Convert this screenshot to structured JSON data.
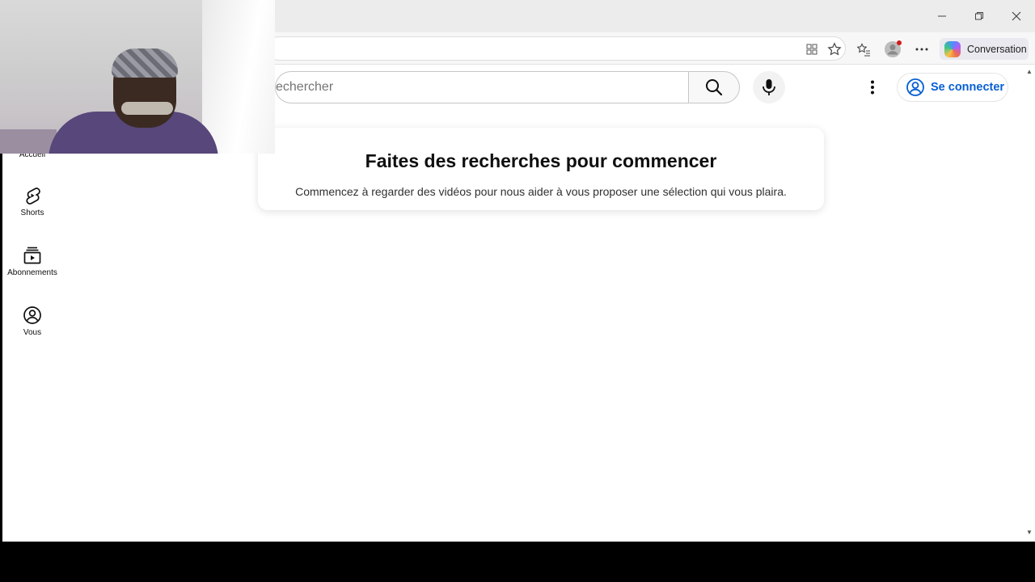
{
  "browser": {
    "copilot_label": "Conversation",
    "window_controls": [
      "minimize-icon",
      "restore-icon",
      "close-icon"
    ],
    "toolbar_icons": [
      "extensions-icon",
      "favorite-star-icon",
      "favorites-list-icon",
      "profile-icon",
      "more-icon"
    ]
  },
  "header": {
    "search_placeholder": "echercher",
    "signin_label": "Se connecter",
    "accent_color": "#065fd4"
  },
  "sidebar": {
    "items": [
      {
        "label": "Accueil",
        "icon": "home-icon"
      },
      {
        "label": "Shorts",
        "icon": "shorts-icon"
      },
      {
        "label": "Abonnements",
        "icon": "subscriptions-icon"
      },
      {
        "label": "Vous",
        "icon": "account-icon"
      }
    ]
  },
  "main": {
    "prompt_title": "Faites des recherches pour commencer",
    "prompt_subtitle": "Commencez à regarder des vidéos pour nous aider à vous proposer une sélection qui vous plaira."
  }
}
